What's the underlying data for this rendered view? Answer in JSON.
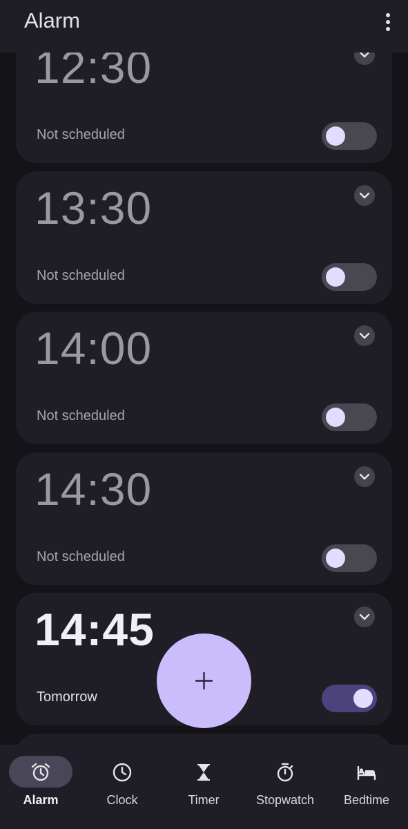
{
  "app": {
    "title": "Alarm"
  },
  "alarms": [
    {
      "time": "12:30",
      "schedule": "Not scheduled",
      "enabled": false
    },
    {
      "time": "13:30",
      "schedule": "Not scheduled",
      "enabled": false
    },
    {
      "time": "14:00",
      "schedule": "Not scheduled",
      "enabled": false
    },
    {
      "time": "14:30",
      "schedule": "Not scheduled",
      "enabled": false
    },
    {
      "time": "14:45",
      "schedule": "Tomorrow",
      "enabled": true
    }
  ],
  "fab": {
    "icon": "plus-icon"
  },
  "nav": [
    {
      "label": "Alarm",
      "icon": "alarm-clock-icon",
      "active": true
    },
    {
      "label": "Clock",
      "icon": "clock-icon",
      "active": false
    },
    {
      "label": "Timer",
      "icon": "hourglass-icon",
      "active": false
    },
    {
      "label": "Stopwatch",
      "icon": "stopwatch-icon",
      "active": false
    },
    {
      "label": "Bedtime",
      "icon": "bed-icon",
      "active": false
    }
  ],
  "colors": {
    "background": "#131318",
    "card": "#1f1e27",
    "accent": "#cbbcfb",
    "toggle_on": "#4d437c",
    "toggle_knob": "#e4dcff"
  }
}
